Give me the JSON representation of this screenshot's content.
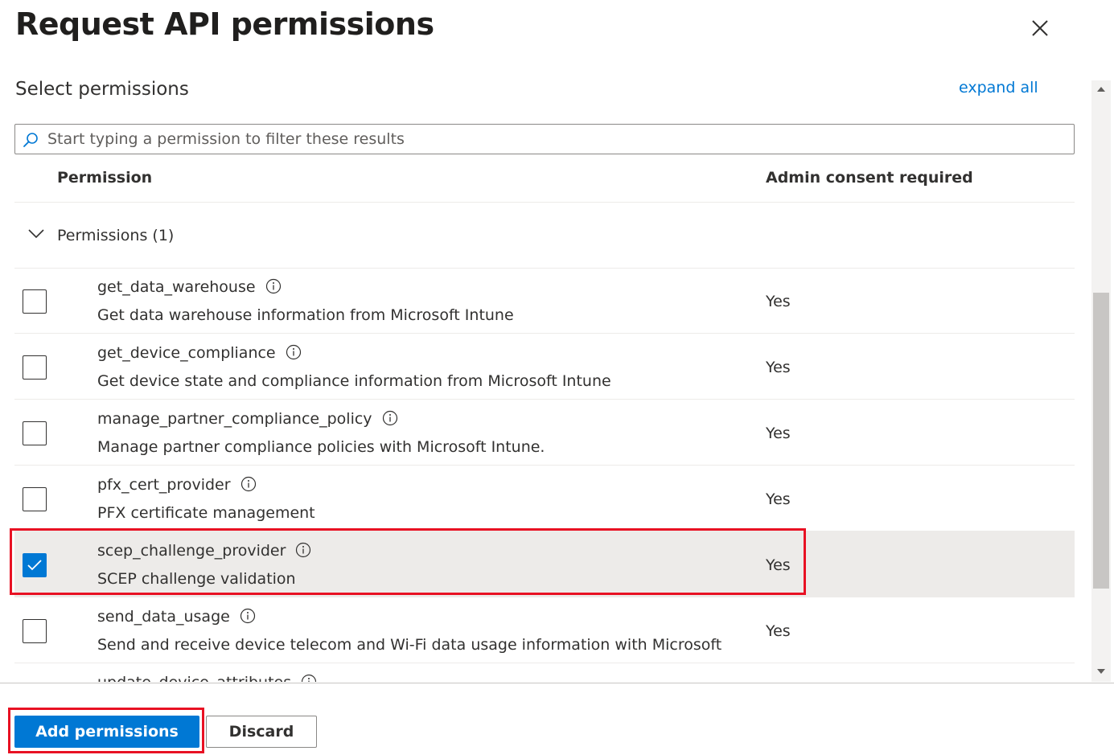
{
  "panel": {
    "title": "Request API permissions",
    "close_icon": "close-icon"
  },
  "section": {
    "title": "Select permissions",
    "expand_all_label": "expand all"
  },
  "search": {
    "placeholder": "Start typing a permission to filter these results",
    "value": "",
    "icon": "search-icon"
  },
  "table": {
    "columns": [
      "Permission",
      "Admin consent required"
    ],
    "group": {
      "label": "Permissions (1)",
      "expanded": true,
      "icon": "chevron-down-icon"
    },
    "rows": [
      {
        "name": "get_data_warehouse",
        "description": "Get data warehouse information from Microsoft Intune",
        "admin_consent": "Yes",
        "checked": false
      },
      {
        "name": "get_device_compliance",
        "description": "Get device state and compliance information from Microsoft Intune",
        "admin_consent": "Yes",
        "checked": false
      },
      {
        "name": "manage_partner_compliance_policy",
        "description": "Manage partner compliance policies with Microsoft Intune.",
        "admin_consent": "Yes",
        "checked": false
      },
      {
        "name": "pfx_cert_provider",
        "description": "PFX certificate management",
        "admin_consent": "Yes",
        "checked": false
      },
      {
        "name": "scep_challenge_provider",
        "description": "SCEP challenge validation",
        "admin_consent": "Yes",
        "checked": true,
        "highlighted": true
      },
      {
        "name": "send_data_usage",
        "description": "Send and receive device telecom and Wi-Fi data usage information with Microsoft",
        "admin_consent": "Yes",
        "checked": false
      },
      {
        "name": "update_device_attributes",
        "description": "",
        "admin_consent": "",
        "checked": false
      }
    ]
  },
  "footer": {
    "primary_label": "Add permissions",
    "secondary_label": "Discard"
  },
  "colors": {
    "accent": "#0078d4",
    "highlight_outline": "#e81123",
    "selected_row_bg": "#edebe9"
  }
}
